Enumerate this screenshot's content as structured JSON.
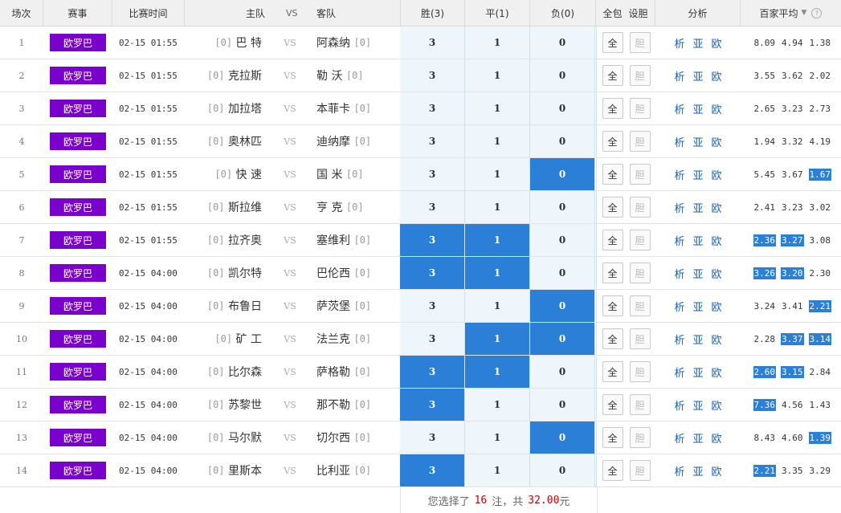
{
  "header": {
    "idx": "场次",
    "league": "赛事",
    "time": "比赛时间",
    "home": "主队",
    "vs": "VS",
    "away": "客队",
    "win": "胜(3)",
    "draw": "平(1)",
    "loss": "负(0)",
    "all": "全包",
    "dan": "设胆",
    "analysis": "分析",
    "avg": "百家平均",
    "avg_dropdown_icon": "chevron-down-icon",
    "help_icon": "question-icon"
  },
  "colors": {
    "league": "#7a00cc",
    "selected": "#2b7fd6",
    "option_bg": "#eef5fb",
    "footer_accent": "#cc0000"
  },
  "matches": [
    {
      "idx": "1",
      "league": "欧罗巴",
      "time": "02-15 01:55",
      "home_rank": "[0]",
      "home": "巴 特",
      "vs": "VS",
      "away": "阿森纳",
      "away_rank": "[0]",
      "win": "3",
      "draw": "1",
      "loss": "0",
      "sel": [
        false,
        false,
        false
      ],
      "all": "全",
      "dan": "胆",
      "a1": "析",
      "a2": "亚",
      "a3": "欧",
      "odds": [
        "8.09",
        "4.94",
        "1.38"
      ],
      "hl": [
        false,
        false,
        false
      ]
    },
    {
      "idx": "2",
      "league": "欧罗巴",
      "time": "02-15 01:55",
      "home_rank": "[0]",
      "home": "克拉斯",
      "vs": "VS",
      "away": "勒 沃",
      "away_rank": "[0]",
      "win": "3",
      "draw": "1",
      "loss": "0",
      "sel": [
        false,
        false,
        false
      ],
      "all": "全",
      "dan": "胆",
      "a1": "析",
      "a2": "亚",
      "a3": "欧",
      "odds": [
        "3.55",
        "3.62",
        "2.02"
      ],
      "hl": [
        false,
        false,
        false
      ]
    },
    {
      "idx": "3",
      "league": "欧罗巴",
      "time": "02-15 01:55",
      "home_rank": "[0]",
      "home": "加拉塔",
      "vs": "VS",
      "away": "本菲卡",
      "away_rank": "[0]",
      "win": "3",
      "draw": "1",
      "loss": "0",
      "sel": [
        false,
        false,
        false
      ],
      "all": "全",
      "dan": "胆",
      "a1": "析",
      "a2": "亚",
      "a3": "欧",
      "odds": [
        "2.65",
        "3.23",
        "2.73"
      ],
      "hl": [
        false,
        false,
        false
      ]
    },
    {
      "idx": "4",
      "league": "欧罗巴",
      "time": "02-15 01:55",
      "home_rank": "[0]",
      "home": "奥林匹",
      "vs": "VS",
      "away": "迪纳摩",
      "away_rank": "[0]",
      "win": "3",
      "draw": "1",
      "loss": "0",
      "sel": [
        false,
        false,
        false
      ],
      "all": "全",
      "dan": "胆",
      "a1": "析",
      "a2": "亚",
      "a3": "欧",
      "odds": [
        "1.94",
        "3.32",
        "4.19"
      ],
      "hl": [
        false,
        false,
        false
      ]
    },
    {
      "idx": "5",
      "league": "欧罗巴",
      "time": "02-15 01:55",
      "home_rank": "[0]",
      "home": "快 速",
      "vs": "VS",
      "away": "国 米",
      "away_rank": "[0]",
      "win": "3",
      "draw": "1",
      "loss": "0",
      "sel": [
        false,
        false,
        true
      ],
      "all": "全",
      "dan": "胆",
      "a1": "析",
      "a2": "亚",
      "a3": "欧",
      "odds": [
        "5.45",
        "3.67",
        "1.67"
      ],
      "hl": [
        false,
        false,
        true
      ]
    },
    {
      "idx": "6",
      "league": "欧罗巴",
      "time": "02-15 01:55",
      "home_rank": "[0]",
      "home": "斯拉维",
      "vs": "VS",
      "away": "亨 克",
      "away_rank": "[0]",
      "win": "3",
      "draw": "1",
      "loss": "0",
      "sel": [
        false,
        false,
        false
      ],
      "all": "全",
      "dan": "胆",
      "a1": "析",
      "a2": "亚",
      "a3": "欧",
      "odds": [
        "2.41",
        "3.23",
        "3.02"
      ],
      "hl": [
        false,
        false,
        false
      ]
    },
    {
      "idx": "7",
      "league": "欧罗巴",
      "time": "02-15 01:55",
      "home_rank": "[0]",
      "home": "拉齐奥",
      "vs": "VS",
      "away": "塞维利",
      "away_rank": "[0]",
      "win": "3",
      "draw": "1",
      "loss": "0",
      "sel": [
        true,
        true,
        false
      ],
      "all": "全",
      "dan": "胆",
      "a1": "析",
      "a2": "亚",
      "a3": "欧",
      "odds": [
        "2.36",
        "3.27",
        "3.08"
      ],
      "hl": [
        true,
        true,
        false
      ]
    },
    {
      "idx": "8",
      "league": "欧罗巴",
      "time": "02-15 04:00",
      "home_rank": "[0]",
      "home": "凯尔特",
      "vs": "VS",
      "away": "巴伦西",
      "away_rank": "[0]",
      "win": "3",
      "draw": "1",
      "loss": "0",
      "sel": [
        true,
        true,
        false
      ],
      "all": "全",
      "dan": "胆",
      "a1": "析",
      "a2": "亚",
      "a3": "欧",
      "odds": [
        "3.26",
        "3.20",
        "2.30"
      ],
      "hl": [
        true,
        true,
        false
      ]
    },
    {
      "idx": "9",
      "league": "欧罗巴",
      "time": "02-15 04:00",
      "home_rank": "[0]",
      "home": "布鲁日",
      "vs": "VS",
      "away": "萨茨堡",
      "away_rank": "[0]",
      "win": "3",
      "draw": "1",
      "loss": "0",
      "sel": [
        false,
        false,
        true
      ],
      "all": "全",
      "dan": "胆",
      "a1": "析",
      "a2": "亚",
      "a3": "欧",
      "odds": [
        "3.24",
        "3.41",
        "2.21"
      ],
      "hl": [
        false,
        false,
        true
      ]
    },
    {
      "idx": "10",
      "league": "欧罗巴",
      "time": "02-15 04:00",
      "home_rank": "[0]",
      "home": "矿 工",
      "vs": "VS",
      "away": "法兰克",
      "away_rank": "[0]",
      "win": "3",
      "draw": "1",
      "loss": "0",
      "sel": [
        false,
        true,
        true
      ],
      "all": "全",
      "dan": "胆",
      "a1": "析",
      "a2": "亚",
      "a3": "欧",
      "odds": [
        "2.28",
        "3.37",
        "3.14"
      ],
      "hl": [
        false,
        true,
        true
      ]
    },
    {
      "idx": "11",
      "league": "欧罗巴",
      "time": "02-15 04:00",
      "home_rank": "[0]",
      "home": "比尔森",
      "vs": "VS",
      "away": "萨格勒",
      "away_rank": "[0]",
      "win": "3",
      "draw": "1",
      "loss": "0",
      "sel": [
        true,
        true,
        false
      ],
      "all": "全",
      "dan": "胆",
      "a1": "析",
      "a2": "亚",
      "a3": "欧",
      "odds": [
        "2.60",
        "3.15",
        "2.84"
      ],
      "hl": [
        true,
        true,
        false
      ]
    },
    {
      "idx": "12",
      "league": "欧罗巴",
      "time": "02-15 04:00",
      "home_rank": "[0]",
      "home": "苏黎世",
      "vs": "VS",
      "away": "那不勒",
      "away_rank": "[0]",
      "win": "3",
      "draw": "1",
      "loss": "0",
      "sel": [
        true,
        false,
        false
      ],
      "all": "全",
      "dan": "胆",
      "a1": "析",
      "a2": "亚",
      "a3": "欧",
      "odds": [
        "7.36",
        "4.56",
        "1.43"
      ],
      "hl": [
        true,
        false,
        false
      ]
    },
    {
      "idx": "13",
      "league": "欧罗巴",
      "time": "02-15 04:00",
      "home_rank": "[0]",
      "home": "马尔默",
      "vs": "VS",
      "away": "切尔西",
      "away_rank": "[0]",
      "win": "3",
      "draw": "1",
      "loss": "0",
      "sel": [
        false,
        false,
        true
      ],
      "all": "全",
      "dan": "胆",
      "a1": "析",
      "a2": "亚",
      "a3": "欧",
      "odds": [
        "8.43",
        "4.60",
        "1.39"
      ],
      "hl": [
        false,
        false,
        true
      ]
    },
    {
      "idx": "14",
      "league": "欧罗巴",
      "time": "02-15 04:00",
      "home_rank": "[0]",
      "home": "里斯本",
      "vs": "VS",
      "away": "比利亚",
      "away_rank": "[0]",
      "win": "3",
      "draw": "1",
      "loss": "0",
      "sel": [
        true,
        false,
        false
      ],
      "all": "全",
      "dan": "胆",
      "a1": "析",
      "a2": "亚",
      "a3": "欧",
      "odds": [
        "2.21",
        "3.35",
        "3.29"
      ],
      "hl": [
        true,
        false,
        false
      ]
    }
  ],
  "footer": {
    "prefix": "您选择了",
    "count": "16",
    "mid": "注，共",
    "amount": "32.00",
    "suffix": "元"
  }
}
